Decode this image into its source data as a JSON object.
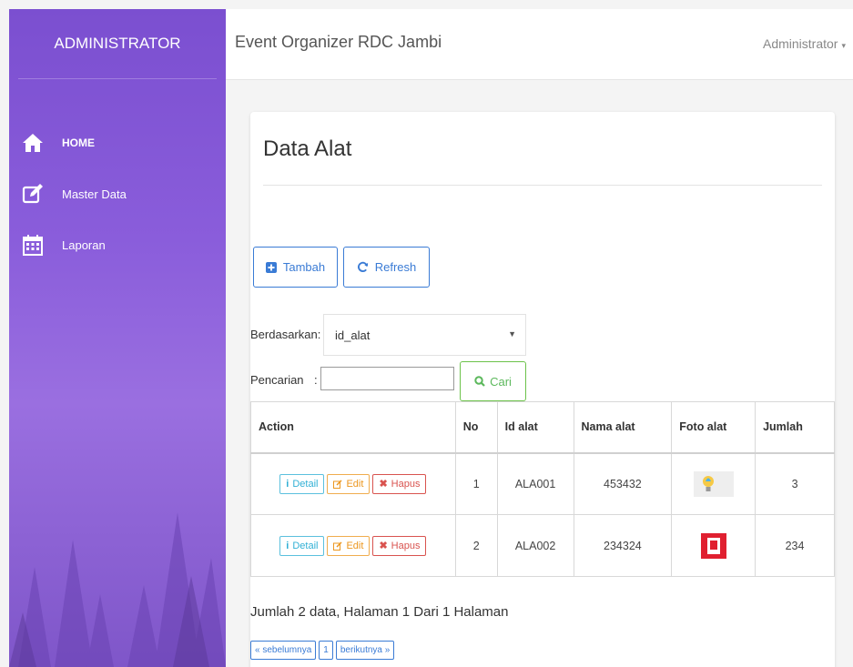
{
  "sidebar": {
    "brand": "ADMINISTRATOR",
    "items": [
      {
        "label": "HOME",
        "icon": "home-icon"
      },
      {
        "label": "Master Data",
        "icon": "edit-icon"
      },
      {
        "label": "Laporan",
        "icon": "calendar-icon"
      }
    ]
  },
  "header": {
    "title": "Event Organizer RDC Jambi",
    "user": "Administrator",
    "caret": "▾"
  },
  "main": {
    "page_title": "Data Alat",
    "tambah_label": "Tambah",
    "refresh_label": "Refresh",
    "filter_label": "Berdasarkan:",
    "filter_value": "id_alat",
    "select_arrow": "▼",
    "search_label": "Pencarian",
    "search_colon": ":",
    "search_value": "",
    "cari_label": "Cari",
    "table": {
      "columns": [
        "Action",
        "No",
        "Id alat",
        "Nama alat",
        "Foto alat",
        "Jumlah"
      ],
      "rows": [
        {
          "no": "1",
          "id": "ALA001",
          "nama": "453432",
          "foto": "lightbulb-photo",
          "jumlah": "3"
        },
        {
          "no": "2",
          "id": "ALA002",
          "nama": "234324",
          "foto": "red-device-photo",
          "jumlah": "234"
        }
      ],
      "actions": {
        "detail": "Detail",
        "edit": "Edit",
        "hapus": "Hapus"
      }
    },
    "summary": "Jumlah 2 data, Halaman 1 Dari 1 Halaman",
    "pager": {
      "prev": "« sebelumnya",
      "page": "1",
      "next": "berikutnya »"
    }
  },
  "colors": {
    "sidebar": "#8a5ddb",
    "primary": "#3a7bd5",
    "success": "#5cb85c",
    "info": "#5bc0de",
    "warning": "#f0ad4e",
    "danger": "#d9534f"
  }
}
